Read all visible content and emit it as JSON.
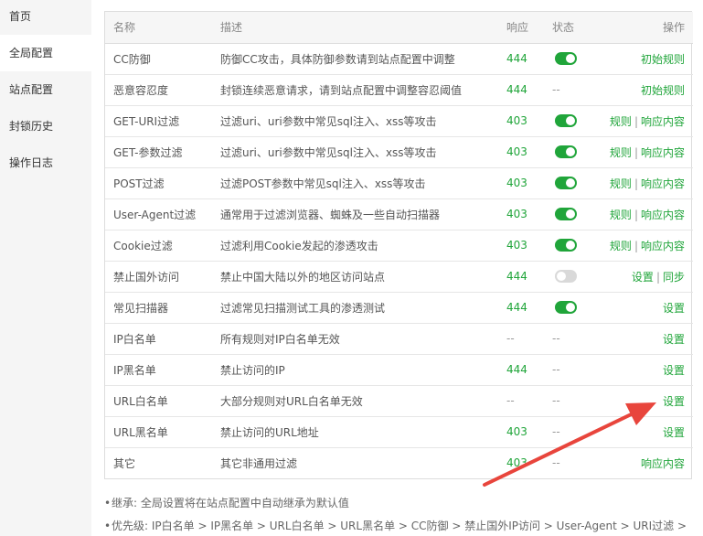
{
  "sidebar": {
    "items": [
      {
        "label": "首页",
        "active": false
      },
      {
        "label": "全局配置",
        "active": true
      },
      {
        "label": "站点配置",
        "active": false
      },
      {
        "label": "封锁历史",
        "active": false
      },
      {
        "label": "操作日志",
        "active": false
      }
    ]
  },
  "table": {
    "headers": {
      "name": "名称",
      "desc": "描述",
      "resp": "响应",
      "state": "状态",
      "op": "操作"
    },
    "rows": [
      {
        "name": "CC防御",
        "desc": "防御CC攻击，具体防御参数请到站点配置中调整",
        "resp": "444",
        "state": "on",
        "ops": [
          "初始规则"
        ]
      },
      {
        "name": "恶意容忍度",
        "desc": "封锁连续恶意请求，请到站点配置中调整容忍阈值",
        "resp": "444",
        "state": "--",
        "ops": [
          "初始规则"
        ]
      },
      {
        "name": "GET-URI过滤",
        "desc": "过滤uri、uri参数中常见sql注入、xss等攻击",
        "resp": "403",
        "state": "on",
        "ops": [
          "规则",
          "响应内容"
        ]
      },
      {
        "name": "GET-参数过滤",
        "desc": "过滤uri、uri参数中常见sql注入、xss等攻击",
        "resp": "403",
        "state": "on",
        "ops": [
          "规则",
          "响应内容"
        ]
      },
      {
        "name": "POST过滤",
        "desc": "过滤POST参数中常见sql注入、xss等攻击",
        "resp": "403",
        "state": "on",
        "ops": [
          "规则",
          "响应内容"
        ]
      },
      {
        "name": "User-Agent过滤",
        "desc": "通常用于过滤浏览器、蜘蛛及一些自动扫描器",
        "resp": "403",
        "state": "on",
        "ops": [
          "规则",
          "响应内容"
        ]
      },
      {
        "name": "Cookie过滤",
        "desc": "过滤利用Cookie发起的渗透攻击",
        "resp": "403",
        "state": "on",
        "ops": [
          "规则",
          "响应内容"
        ]
      },
      {
        "name": "禁止国外访问",
        "desc": "禁止中国大陆以外的地区访问站点",
        "resp": "444",
        "state": "off",
        "ops": [
          "设置",
          "同步"
        ]
      },
      {
        "name": "常见扫描器",
        "desc": "过滤常见扫描测试工具的渗透测试",
        "resp": "444",
        "state": "on",
        "ops": [
          "设置"
        ]
      },
      {
        "name": "IP白名单",
        "desc": "所有规则对IP白名单无效",
        "resp": "--",
        "state": "--",
        "ops": [
          "设置"
        ]
      },
      {
        "name": "IP黑名单",
        "desc": "禁止访问的IP",
        "resp": "444",
        "state": "--",
        "ops": [
          "设置"
        ]
      },
      {
        "name": "URL白名单",
        "desc": "大部分规则对URL白名单无效",
        "resp": "--",
        "state": "--",
        "ops": [
          "设置"
        ]
      },
      {
        "name": "URL黑名单",
        "desc": "禁止访问的URL地址",
        "resp": "403",
        "state": "--",
        "ops": [
          "设置"
        ]
      },
      {
        "name": "其它",
        "desc": "其它非通用过滤",
        "resp": "403",
        "state": "--",
        "ops": [
          "响应内容"
        ]
      }
    ]
  },
  "notes": [
    "继承: 全局设置将在站点配置中自动继承为默认值",
    "优先级: IP白名单 > IP黑名单 > URL白名单 > URL黑名单 > CC防御 > 禁止国外IP访问 > User-Agent > URI过滤 >"
  ],
  "colors": {
    "accent": "#20a53a",
    "arrow": "#e8453c",
    "toggle_off": "#d9d9d9"
  }
}
